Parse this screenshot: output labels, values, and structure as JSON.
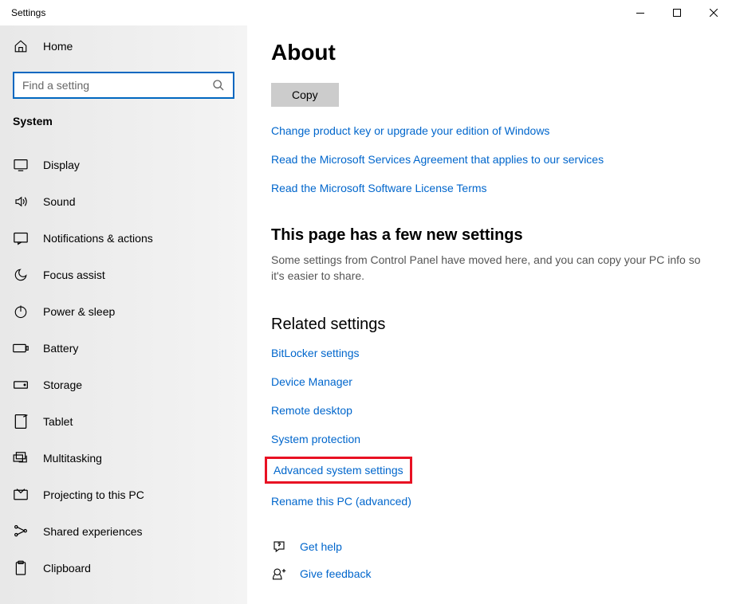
{
  "window": {
    "title": "Settings"
  },
  "sidebar": {
    "home": "Home",
    "search_placeholder": "Find a setting",
    "category": "System",
    "items": [
      {
        "label": "Display"
      },
      {
        "label": "Sound"
      },
      {
        "label": "Notifications & actions"
      },
      {
        "label": "Focus assist"
      },
      {
        "label": "Power & sleep"
      },
      {
        "label": "Battery"
      },
      {
        "label": "Storage"
      },
      {
        "label": "Tablet"
      },
      {
        "label": "Multitasking"
      },
      {
        "label": "Projecting to this PC"
      },
      {
        "label": "Shared experiences"
      },
      {
        "label": "Clipboard"
      }
    ]
  },
  "main": {
    "title": "About",
    "copy_button": "Copy",
    "links": [
      "Change product key or upgrade your edition of Windows",
      "Read the Microsoft Services Agreement that applies to our services",
      "Read the Microsoft Software License Terms"
    ],
    "new_settings": {
      "title": "This page has a few new settings",
      "text": "Some settings from Control Panel have moved here, and you can copy your PC info so it's easier to share."
    },
    "related": {
      "title": "Related settings",
      "links": [
        "BitLocker settings",
        "Device Manager",
        "Remote desktop",
        "System protection",
        "Advanced system settings",
        "Rename this PC (advanced)"
      ]
    },
    "help": {
      "get_help": "Get help",
      "give_feedback": "Give feedback"
    }
  }
}
